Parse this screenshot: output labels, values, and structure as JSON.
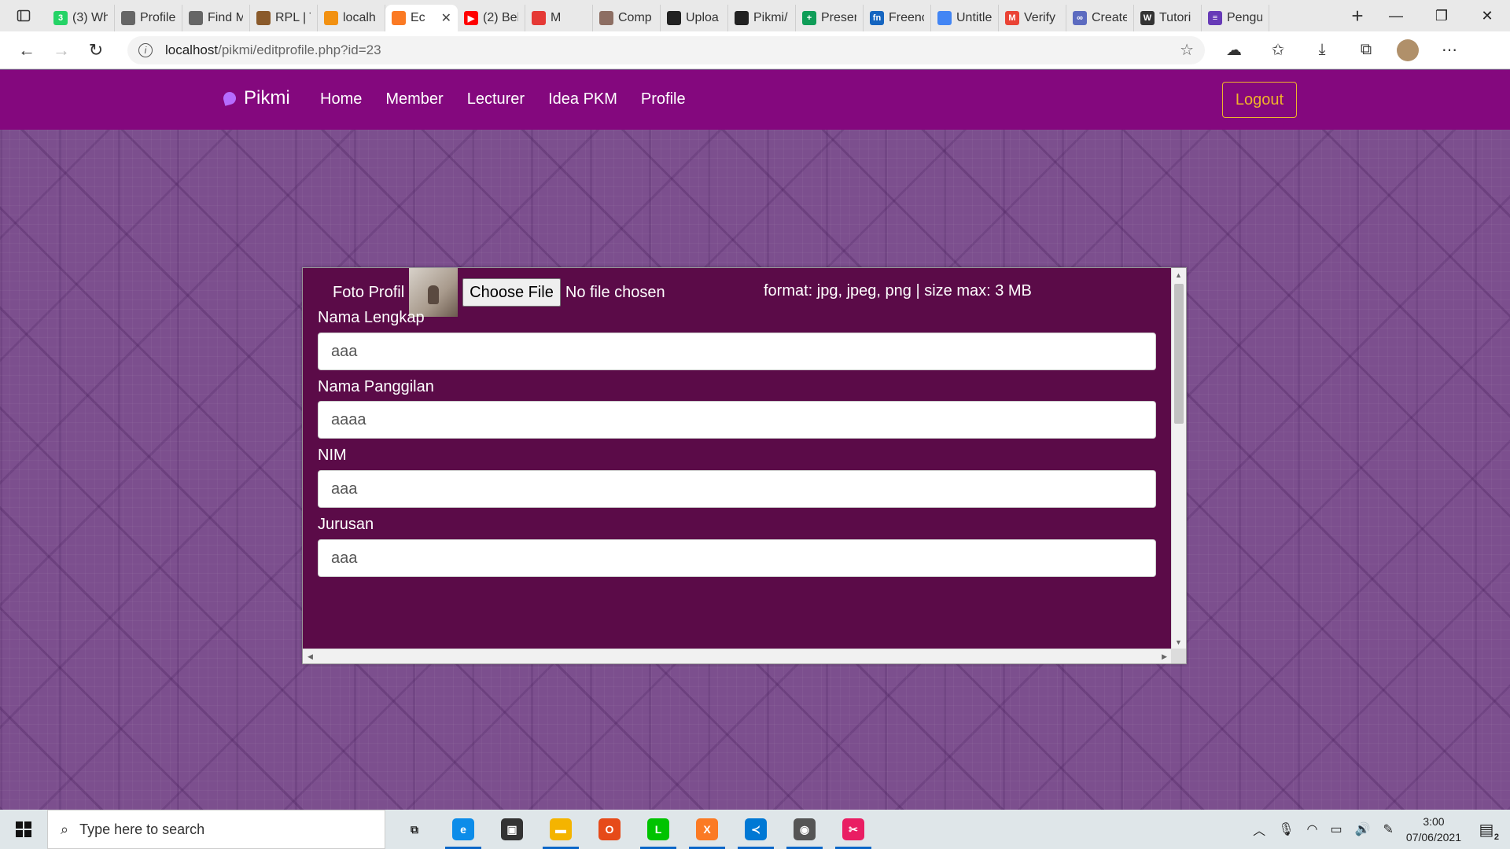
{
  "browser": {
    "tabs": [
      {
        "title": "(3) Wh",
        "icon": "whatsapp-icon",
        "color": "#25d366",
        "glyph": "3"
      },
      {
        "title": "Profile",
        "icon": "page-icon",
        "color": "#666666",
        "glyph": ""
      },
      {
        "title": "Find M",
        "icon": "page-icon",
        "color": "#666666",
        "glyph": ""
      },
      {
        "title": "RPL | T",
        "icon": "book-icon",
        "color": "#8a5a2b",
        "glyph": ""
      },
      {
        "title": "localh",
        "icon": "phpmyadmin-icon",
        "color": "#f29111",
        "glyph": ""
      },
      {
        "title": "Ec",
        "icon": "xampp-icon",
        "color": "#fb7a24",
        "glyph": "",
        "active": true
      },
      {
        "title": "(2) Bel",
        "icon": "youtube-icon",
        "color": "#ff0000",
        "glyph": "▶"
      },
      {
        "title": "M",
        "icon": "record-icon",
        "color": "#e53935",
        "glyph": ""
      },
      {
        "title": "Comp",
        "icon": "cat-icon",
        "color": "#8d6e63",
        "glyph": ""
      },
      {
        "title": "Uploa",
        "icon": "github-icon",
        "color": "#222222",
        "glyph": ""
      },
      {
        "title": "Pikmi/",
        "icon": "github-icon",
        "color": "#222222",
        "glyph": ""
      },
      {
        "title": "Preser",
        "icon": "sheets-icon",
        "color": "#0f9d58",
        "glyph": "+"
      },
      {
        "title": "Freenc",
        "icon": "freenom-icon",
        "color": "#1565c0",
        "glyph": "fn"
      },
      {
        "title": "Untitle",
        "icon": "docs-icon",
        "color": "#4285f4",
        "glyph": ""
      },
      {
        "title": "Verify",
        "icon": "gmail-icon",
        "color": "#ea4335",
        "glyph": "M"
      },
      {
        "title": "Create",
        "icon": "infinity-icon",
        "color": "#5c6bc0",
        "glyph": "∞"
      },
      {
        "title": "Tutori",
        "icon": "w3schools-icon",
        "color": "#333333",
        "glyph": "W"
      },
      {
        "title": "Pengu",
        "icon": "forms-icon",
        "color": "#673ab7",
        "glyph": "≡"
      }
    ],
    "url_host": "localhost",
    "url_path": "/pikmi/editprofile.php?id=23"
  },
  "site": {
    "brand": "Pikmi",
    "nav": [
      "Home",
      "Member",
      "Lecturer",
      "Idea PKM",
      "Profile"
    ],
    "logout": "Logout"
  },
  "form": {
    "photo_label": "Foto Profil",
    "choose_file": "Choose File",
    "no_file": "No file chosen",
    "format_hint": "format: jpg, jpeg, png | size max: 3 MB",
    "fields": [
      {
        "label": "Nama Lengkap",
        "value": "aaa"
      },
      {
        "label": "Nama Panggilan",
        "value": "aaaa"
      },
      {
        "label": "NIM",
        "value": "aaa"
      },
      {
        "label": "Jurusan",
        "value": "aaa"
      }
    ]
  },
  "taskbar": {
    "search_placeholder": "Type here to search",
    "apps": [
      {
        "name": "task-view-icon",
        "color": "#dfe6e9",
        "glyph": "⧉",
        "running": false
      },
      {
        "name": "edge-icon",
        "color": "#0c8ce9",
        "glyph": "e",
        "running": true
      },
      {
        "name": "store-icon",
        "color": "#333333",
        "glyph": "▣",
        "running": false
      },
      {
        "name": "file-explorer-icon",
        "color": "#f4b400",
        "glyph": "▬",
        "running": true
      },
      {
        "name": "office-icon",
        "color": "#e64a19",
        "glyph": "O",
        "running": false
      },
      {
        "name": "line-icon",
        "color": "#00c300",
        "glyph": "L",
        "running": true
      },
      {
        "name": "xampp-icon",
        "color": "#fb7a24",
        "glyph": "X",
        "running": true
      },
      {
        "name": "vscode-icon",
        "color": "#0078d4",
        "glyph": "≺",
        "running": true
      },
      {
        "name": "git-panda-icon",
        "color": "#555555",
        "glyph": "◉",
        "running": true
      },
      {
        "name": "snip-icon",
        "color": "#e91e63",
        "glyph": "✂",
        "running": true
      }
    ],
    "time": "3:00",
    "date": "07/06/2021",
    "notifications": "2"
  }
}
